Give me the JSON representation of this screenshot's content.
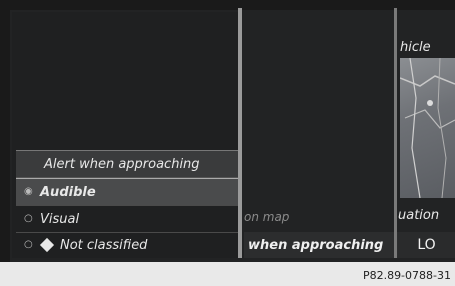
{
  "menu": {
    "header": "Alert when approaching",
    "items": [
      {
        "label": "Audible",
        "selected": true
      },
      {
        "label": "Visual",
        "selected": false
      },
      {
        "label": "Not classified",
        "selected": false
      }
    ]
  },
  "middle": {
    "on_map": "on map",
    "bottom_label": "when approaching"
  },
  "right": {
    "top_label": "hicle",
    "mid_label": "uation",
    "bottom_label": "LO"
  },
  "caption": "P82.89-0788-31"
}
